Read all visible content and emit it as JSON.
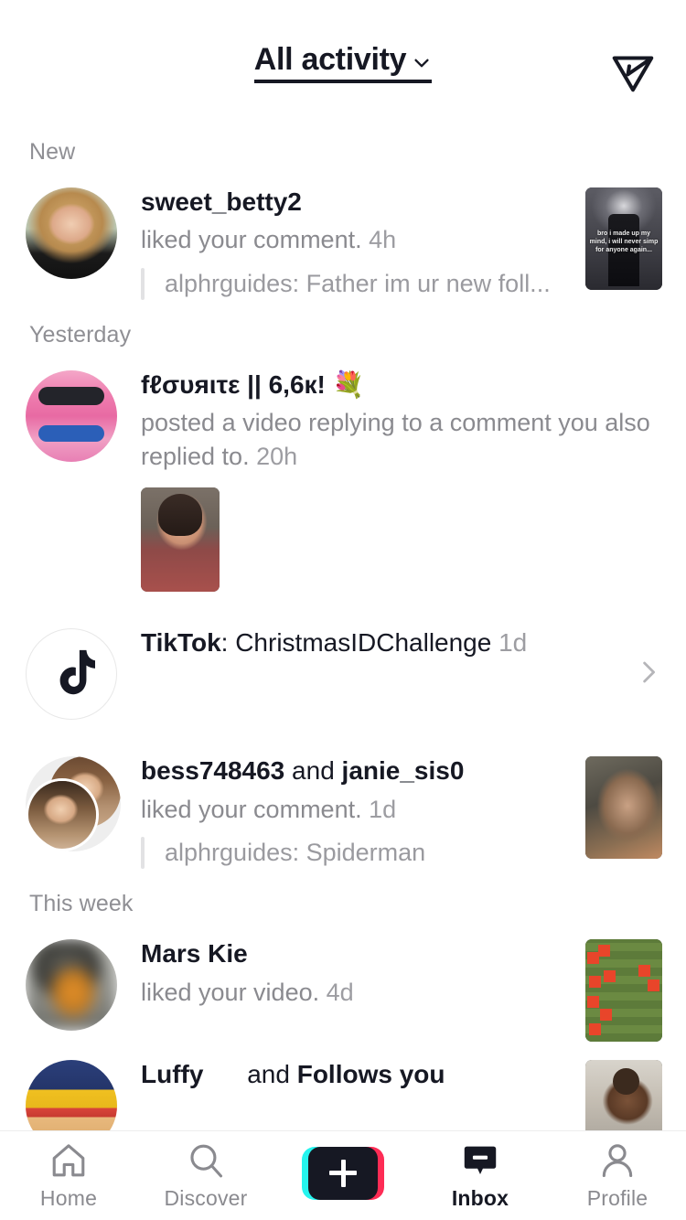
{
  "header": {
    "title": "All activity",
    "chevron_icon": "chevron-down-icon",
    "send_icon": "send-plane-icon"
  },
  "sections": [
    {
      "label": "New",
      "items": [
        {
          "id": "sweet-betty2",
          "avatar_type": "single",
          "username": "sweet_betty2",
          "action": "liked your comment.",
          "time": "4h",
          "quote": "alphrguides: Father im ur new foll...",
          "thumb": "anime",
          "thumb_overlay": "bro i made up my mind, i will never simp for anyone again..."
        }
      ]
    },
    {
      "label": "Yesterday",
      "items": [
        {
          "id": "flourite",
          "avatar_type": "single",
          "username": "fℓσυяιτε || 6,6к! 💐",
          "action": "posted a video replying to a comment you also replied to.",
          "time": "20h",
          "inline_thumb": "girl"
        },
        {
          "id": "tiktok-official",
          "avatar_type": "tiktok-logo",
          "username": "TikTok",
          "suffix": ": ChristmasIDChallenge",
          "time": "1d",
          "chevron": "chevron-right-icon"
        },
        {
          "id": "bess-janie",
          "avatar_type": "stacked",
          "username": "bess748463",
          "conjunction": "and",
          "username2": "janie_sis0",
          "action": "liked your comment.",
          "time": "1d",
          "quote": "alphrguides: Spiderman",
          "thumb": "spider"
        }
      ]
    },
    {
      "label": "This week",
      "items": [
        {
          "id": "mars-kie",
          "avatar_type": "blurred",
          "username": "Mars Kie",
          "action": "liked your video.",
          "time": "4d",
          "thumb": "minecraft"
        },
        {
          "id": "luffy",
          "avatar_type": "luffy",
          "username": "Luffy",
          "conjunction": "and",
          "username2": "Follows you",
          "thumb": "girl2"
        }
      ]
    }
  ],
  "tabbar": {
    "items": [
      {
        "label": "Home",
        "icon": "home-icon",
        "active": false
      },
      {
        "label": "Discover",
        "icon": "search-icon",
        "active": false
      },
      {
        "label": "",
        "icon": "create-plus-icon",
        "active": false
      },
      {
        "label": "Inbox",
        "icon": "inbox-icon",
        "active": true
      },
      {
        "label": "Profile",
        "icon": "person-icon",
        "active": false
      }
    ]
  },
  "colors": {
    "text_primary": "#161823",
    "text_secondary": "#8a8a8f",
    "accent_cyan": "#25F4EE",
    "accent_pink": "#FE2C55"
  }
}
